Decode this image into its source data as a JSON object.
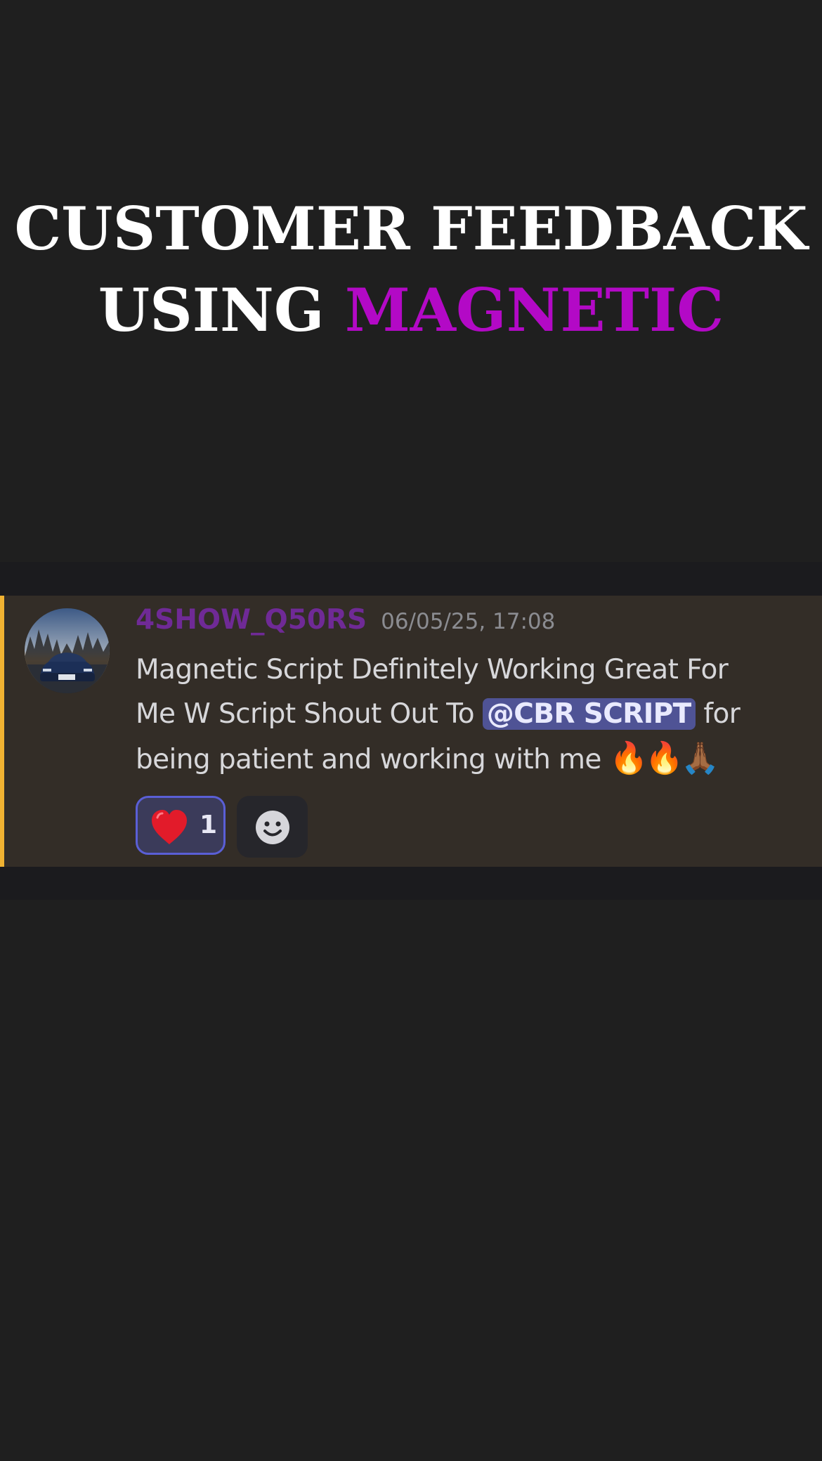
{
  "headline": {
    "line1": "CUSTOMER FEEDBACK",
    "line2_prefix": "USING ",
    "line2_accent": "MAGNETIC"
  },
  "message": {
    "username": "4SHOW_Q50RS",
    "timestamp": "06/05/25, 17:08",
    "text_line1": "Magnetic Script Definitely Working Great For",
    "text_line2_prefix": "Me W Script Shout Out To ",
    "mention": "@CBR SCRIPT",
    "text_line2_suffix": "  for",
    "text_line3": "being patient and working with me ",
    "emojis": "🔥🔥🙏🏾"
  },
  "reactions": [
    {
      "emoji": "red-heart",
      "count": "1",
      "selected": true
    }
  ],
  "icons": {
    "avatar": "car-avatar-image",
    "add_reaction": "add-reaction-smiley-icon"
  },
  "colors": {
    "accent_magenta": "#b309c6",
    "username": "#6f2a96",
    "mention_bg": "#4f5395",
    "highlight_stripe": "#f0b232",
    "message_bg": "#332d27"
  }
}
